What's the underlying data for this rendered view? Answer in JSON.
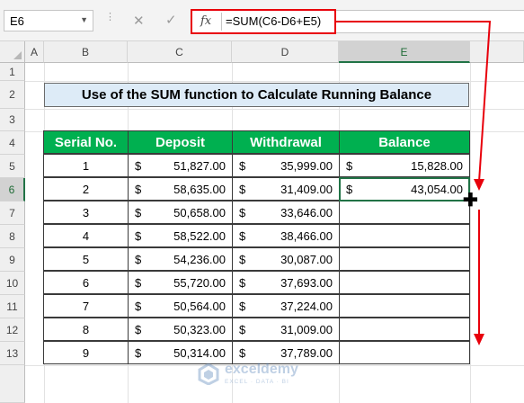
{
  "name_box": "E6",
  "formula_bar": {
    "fx_label": "fx",
    "formula": "=SUM(C6-D6+E5)"
  },
  "column_headers": [
    "A",
    "B",
    "C",
    "D",
    "E"
  ],
  "row_headers": [
    "1",
    "2",
    "3",
    "4",
    "5",
    "6",
    "7",
    "8",
    "9",
    "10",
    "11",
    "12",
    "13"
  ],
  "title": "Use of the SUM function to Calculate Running Balance",
  "table": {
    "headers": [
      "Serial No.",
      "Deposit",
      "Withdrawal",
      "Balance"
    ],
    "currency_symbol": "$",
    "rows": [
      {
        "serial": "1",
        "deposit": "51,827.00",
        "withdrawal": "35,999.00",
        "balance": "15,828.00"
      },
      {
        "serial": "2",
        "deposit": "58,635.00",
        "withdrawal": "31,409.00",
        "balance": "43,054.00"
      },
      {
        "serial": "3",
        "deposit": "50,658.00",
        "withdrawal": "33,646.00",
        "balance": ""
      },
      {
        "serial": "4",
        "deposit": "58,522.00",
        "withdrawal": "38,466.00",
        "balance": ""
      },
      {
        "serial": "5",
        "deposit": "54,236.00",
        "withdrawal": "30,087.00",
        "balance": ""
      },
      {
        "serial": "6",
        "deposit": "55,720.00",
        "withdrawal": "37,693.00",
        "balance": ""
      },
      {
        "serial": "7",
        "deposit": "50,564.00",
        "withdrawal": "37,224.00",
        "balance": ""
      },
      {
        "serial": "8",
        "deposit": "50,323.00",
        "withdrawal": "31,009.00",
        "balance": ""
      },
      {
        "serial": "9",
        "deposit": "50,314.00",
        "withdrawal": "37,789.00",
        "balance": ""
      }
    ]
  },
  "watermark": {
    "name": "exceldemy",
    "tagline": "EXCEL · DATA · BI"
  },
  "colors": {
    "header_green": "#00b050",
    "title_fill": "#ddebf7",
    "annotation_red": "#e8000b",
    "selection_green": "#217346"
  }
}
